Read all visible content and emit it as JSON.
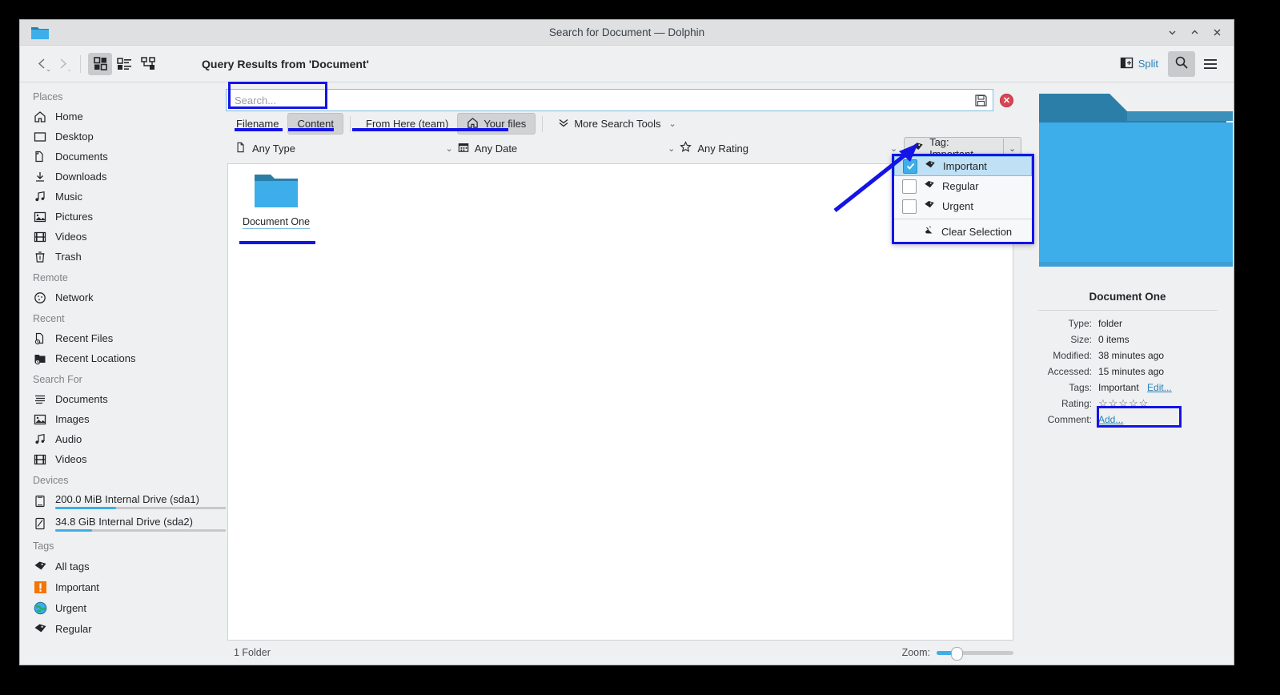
{
  "window": {
    "title": "Search for Document — Dolphin",
    "app_icon": "folder-icon",
    "minimize_label": "Minimize",
    "maximize_label": "Maximize",
    "close_label": "Close"
  },
  "toolbar": {
    "back_label": "Back",
    "forward_label": "Forward",
    "view_icons_label": "Icons view",
    "view_details_label": "Details view",
    "view_compact_label": "Compact view",
    "breadcrumb": "Query Results from 'Document'",
    "split_label": "Split",
    "search_label": "Search",
    "menu_label": "Menu"
  },
  "sidebar": {
    "groups": [
      {
        "title": "Places",
        "items": [
          {
            "label": "Home",
            "icon": "home-icon"
          },
          {
            "label": "Desktop",
            "icon": "desktop-icon"
          },
          {
            "label": "Documents",
            "icon": "documents-icon"
          },
          {
            "label": "Downloads",
            "icon": "downloads-icon"
          },
          {
            "label": "Music",
            "icon": "music-icon"
          },
          {
            "label": "Pictures",
            "icon": "pictures-icon"
          },
          {
            "label": "Videos",
            "icon": "videos-icon"
          },
          {
            "label": "Trash",
            "icon": "trash-icon"
          }
        ]
      },
      {
        "title": "Remote",
        "items": [
          {
            "label": "Network",
            "icon": "network-icon"
          }
        ]
      },
      {
        "title": "Recent",
        "items": [
          {
            "label": "Recent Files",
            "icon": "recent-files-icon"
          },
          {
            "label": "Recent Locations",
            "icon": "recent-locations-icon"
          }
        ]
      },
      {
        "title": "Search For",
        "items": [
          {
            "label": "Documents",
            "icon": "documents-icon"
          },
          {
            "label": "Images",
            "icon": "images-icon"
          },
          {
            "label": "Audio",
            "icon": "audio-icon"
          },
          {
            "label": "Videos",
            "icon": "videos-icon"
          }
        ]
      },
      {
        "title": "Devices",
        "items": [
          {
            "label": "200.0 MiB Internal Drive (sda1)",
            "icon": "drive-icon",
            "usage_percent": 35
          },
          {
            "label": "34.8 GiB Internal Drive (sda2)",
            "icon": "drive-icon",
            "usage_percent": 21
          }
        ]
      },
      {
        "title": "Tags",
        "items": [
          {
            "label": "All tags",
            "icon": "tag-icon"
          },
          {
            "label": "Important",
            "icon": "important-tag-icon"
          },
          {
            "label": "Urgent",
            "icon": "urgent-tag-icon"
          },
          {
            "label": "Regular",
            "icon": "tag-icon"
          }
        ]
      }
    ]
  },
  "search": {
    "value": "",
    "placeholder": "Search...",
    "save_icon": "save-icon",
    "close_icon": "close-search-icon",
    "scope_tabs": [
      {
        "label": "Filename",
        "selected": false
      },
      {
        "label": "Content",
        "selected": true
      }
    ],
    "location_tabs": [
      {
        "label": "From Here (team)",
        "selected": false
      },
      {
        "label": "Your files",
        "selected": true,
        "icon": "home-icon"
      }
    ],
    "more_tools_label": "More Search Tools",
    "filters": [
      {
        "label": "Any Type",
        "icon": "file-icon"
      },
      {
        "label": "Any Date",
        "icon": "calendar-icon"
      },
      {
        "label": "Any Rating",
        "icon": "star-icon"
      }
    ],
    "tag_filter": {
      "label": "Tag: Important",
      "icon": "tag-icon"
    }
  },
  "tag_menu": {
    "options": [
      {
        "label": "Important",
        "checked": true,
        "highlighted": true
      },
      {
        "label": "Regular",
        "checked": false,
        "highlighted": false
      },
      {
        "label": "Urgent",
        "checked": false,
        "highlighted": false
      }
    ],
    "clear_label": "Clear Selection",
    "clear_icon": "clear-selection-icon"
  },
  "files": [
    {
      "name": "Document One",
      "icon": "folder-icon"
    }
  ],
  "statusbar": {
    "count_text": "1 Folder",
    "zoom_label": "Zoom:",
    "zoom_percent": 22
  },
  "info_panel": {
    "preview_icon": "folder-icon",
    "title": "Document One",
    "rows": [
      {
        "key": "Type:",
        "value": "folder"
      },
      {
        "key": "Size:",
        "value": "0 items"
      },
      {
        "key": "Modified:",
        "value": "38 minutes ago"
      },
      {
        "key": "Accessed:",
        "value": "15 minutes ago"
      }
    ],
    "tags_key": "Tags:",
    "tags_value": "Important",
    "tags_edit": "Edit...",
    "rating_key": "Rating:",
    "rating_stars": "☆☆☆☆☆",
    "rating_value": 0,
    "comment_key": "Comment:",
    "comment_add": "Add..."
  },
  "colors": {
    "annotation": "#1414e6",
    "accent": "#3daee9",
    "folder_dark": "#2980a8",
    "folder_light": "#3daee9",
    "close_red": "#da4453",
    "link": "#2980b9"
  }
}
